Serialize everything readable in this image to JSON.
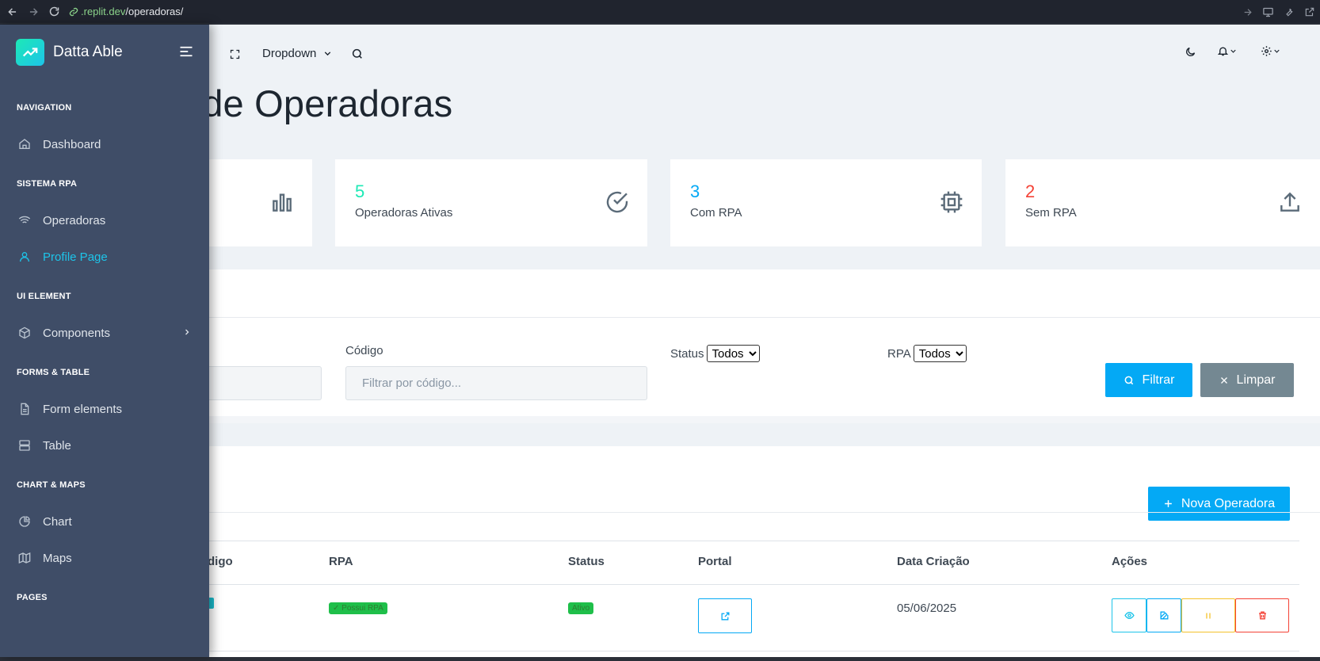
{
  "browser": {
    "url_host": ".replit.dev",
    "url_path": "/operadoras/"
  },
  "header": {
    "dropdown_label": "Dropdown"
  },
  "page": {
    "title": "nto de Operadoras"
  },
  "stats": [
    {
      "value": "",
      "label": "",
      "icon": "bar-chart-icon",
      "color": "#04a9f5"
    },
    {
      "value": "5",
      "label": "Operadoras Ativas",
      "icon": "check-circle-icon",
      "color": "#1de9b6"
    },
    {
      "value": "3",
      "label": "Com RPA",
      "icon": "cpu-icon",
      "color": "#04a9f5"
    },
    {
      "value": "2",
      "label": "Sem RPA",
      "icon": "upload-icon",
      "color": "#f44236"
    }
  ],
  "filters": {
    "codigo_label": "Código",
    "codigo_placeholder": "Filtrar por código...",
    "status_label": "Status",
    "status_selected": "Todos",
    "rpa_label": "RPA",
    "rpa_selected": "Todos",
    "filter_button": "Filtrar",
    "clear_button": "Limpar"
  },
  "table": {
    "new_button": "Nova Operadora",
    "headers": {
      "codigo": "digo",
      "rpa": "RPA",
      "status": "Status",
      "portal": "Portal",
      "data_criacao": "Data Criação",
      "acoes": "Ações"
    },
    "rows": [
      {
        "rpa_badge": "✓ Possui RPA",
        "status_badge": "Ativo",
        "data_criacao": "05/06/2025"
      }
    ]
  },
  "sidebar": {
    "brand": "Datta Able",
    "sections": [
      {
        "caption": "NAVIGATION",
        "items": [
          {
            "label": "Dashboard",
            "icon": "home-icon"
          }
        ]
      },
      {
        "caption": "SISTEMA RPA",
        "items": [
          {
            "label": "Operadoras",
            "icon": "wifi-icon"
          },
          {
            "label": "Profile Page",
            "icon": "user-icon",
            "active": true
          }
        ]
      },
      {
        "caption": "UI ELEMENT",
        "items": [
          {
            "label": "Components",
            "icon": "box-icon",
            "has_submenu": true
          }
        ]
      },
      {
        "caption": "FORMS & TABLE",
        "items": [
          {
            "label": "Form elements",
            "icon": "file-text-icon"
          },
          {
            "label": "Table",
            "icon": "server-icon"
          }
        ]
      },
      {
        "caption": "CHART & MAPS",
        "items": [
          {
            "label": "Chart",
            "icon": "pie-chart-icon"
          },
          {
            "label": "Maps",
            "icon": "map-icon"
          }
        ]
      },
      {
        "caption": "PAGES",
        "items": []
      }
    ]
  },
  "colors": {
    "primary": "#04a9f5",
    "secondary": "#748892",
    "sidebar_bg": "#3f4d67",
    "active_nav": "#1dc4e9",
    "success": "#1de9b6",
    "danger": "#f44236",
    "warning": "#f4c22b"
  }
}
